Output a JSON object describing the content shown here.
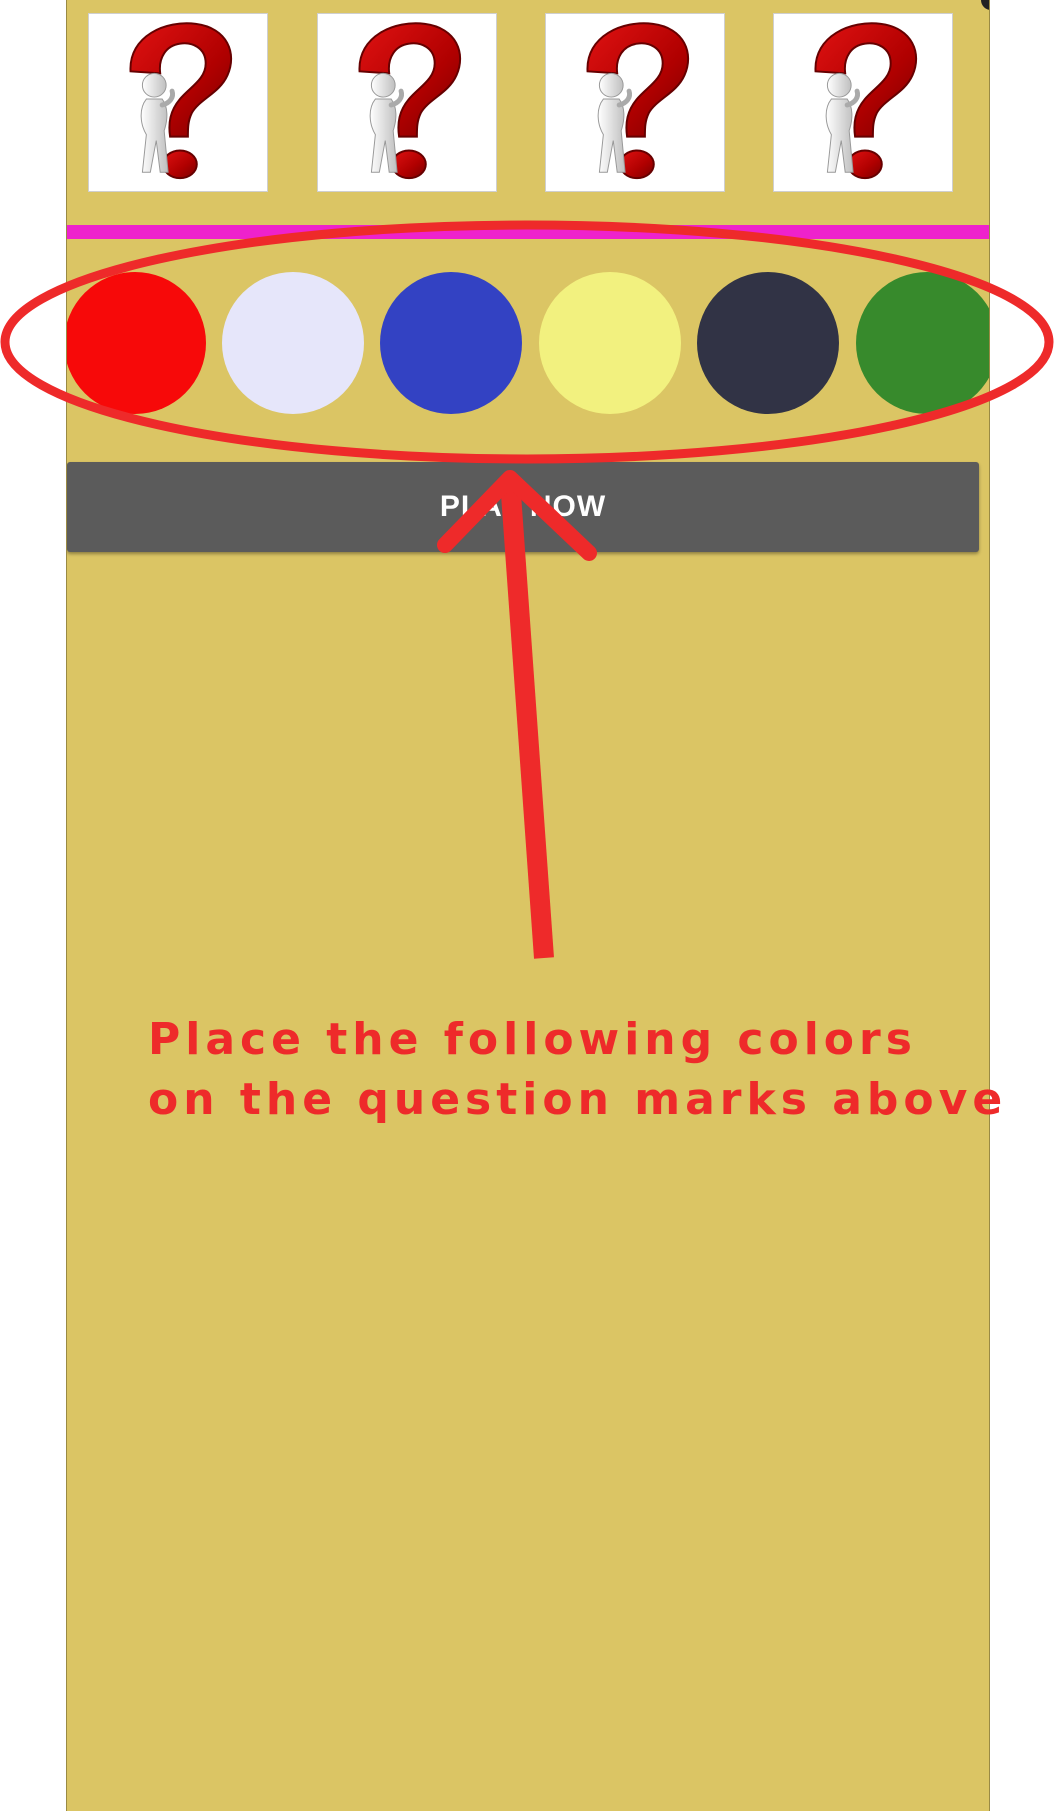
{
  "slots": [
    {
      "icon": "question-mark-figure-icon"
    },
    {
      "icon": "question-mark-figure-icon"
    },
    {
      "icon": "question-mark-figure-icon"
    },
    {
      "icon": "question-mark-figure-icon"
    }
  ],
  "palette": [
    {
      "name": "red",
      "color": "#f70909"
    },
    {
      "name": "lavender",
      "color": "#e6e6fa"
    },
    {
      "name": "blue",
      "color": "#3342c3"
    },
    {
      "name": "light-yellow",
      "color": "#f2f17f"
    },
    {
      "name": "dark-navy",
      "color": "#313345"
    },
    {
      "name": "green",
      "color": "#378a2c"
    }
  ],
  "play_button": {
    "label": "PLAY NOW"
  },
  "annotation": {
    "line1": "Place the following colors",
    "line2": "on the question marks above",
    "color": "#ee2a2a"
  },
  "colors": {
    "background": "#dbc564",
    "divider": "#ee22cc",
    "button": "#5b5b5b"
  }
}
